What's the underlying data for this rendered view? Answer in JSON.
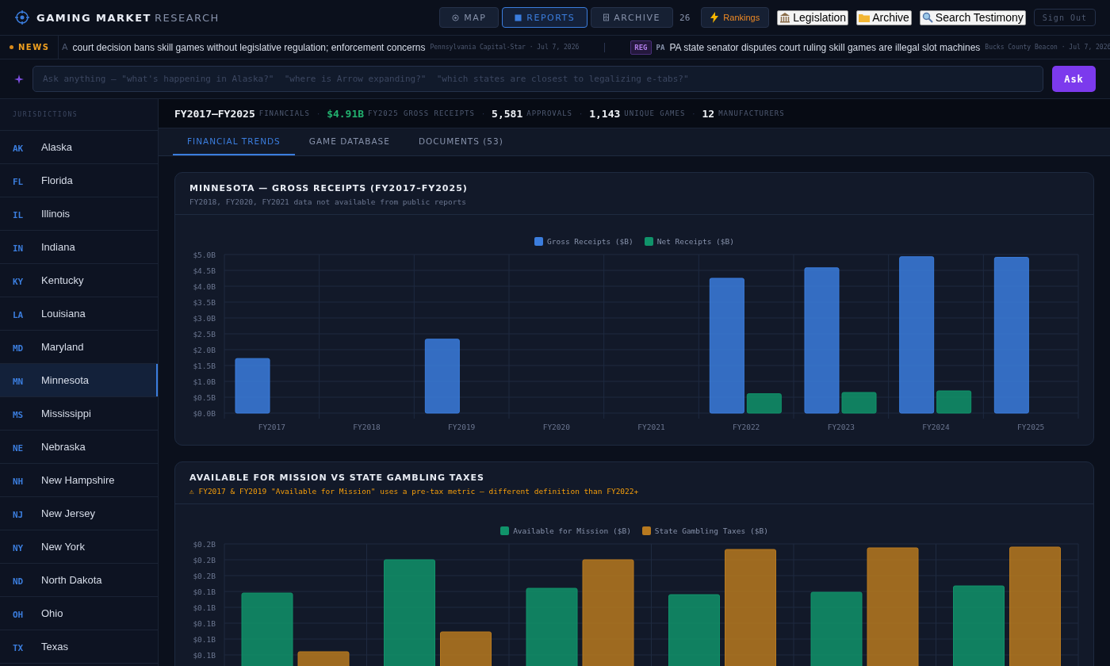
{
  "brand": {
    "name": "GAMING MARKET",
    "suffix": "RESEARCH"
  },
  "nav": [
    {
      "label": "MAP",
      "selected": false
    },
    {
      "label": "REPORTS",
      "selected": true
    },
    {
      "label": "ARCHIVE",
      "selected": false
    }
  ],
  "nav_count": "26",
  "rankings": "Rankings",
  "links": [
    {
      "label": "Legislation"
    },
    {
      "label": "Archive"
    },
    {
      "label": "Search Testimony"
    }
  ],
  "sign_out": "Sign Out",
  "news": {
    "label": "NEWS",
    "items": [
      {
        "state": "A",
        "headline": "court decision bans skill games without legislative regulation; enforcement concerns",
        "source": "Pennsylvania Capital-Star · Jul 7, 2026"
      },
      {
        "tag": "REG",
        "state": "PA",
        "headline": "PA state senator disputes court ruling skill games are illegal slot machines",
        "source": "Bucks County Beacon · Jul 7, 2026"
      }
    ]
  },
  "ask": {
    "placeholder": "Ask anything — \"what's happening in Alaska?\"  \"where is Arrow expanding?\"  \"which states are closest to legalizing e-tabs?\"",
    "button": "Ask"
  },
  "sidebar": {
    "title": "JURISDICTIONS",
    "items": [
      {
        "code": "AK",
        "name": "Alaska",
        "selected": false
      },
      {
        "code": "FL",
        "name": "Florida",
        "selected": false
      },
      {
        "code": "IL",
        "name": "Illinois",
        "selected": false
      },
      {
        "code": "IN",
        "name": "Indiana",
        "selected": false
      },
      {
        "code": "KY",
        "name": "Kentucky",
        "selected": false
      },
      {
        "code": "LA",
        "name": "Louisiana",
        "selected": false
      },
      {
        "code": "MD",
        "name": "Maryland",
        "selected": false
      },
      {
        "code": "MN",
        "name": "Minnesota",
        "selected": true
      },
      {
        "code": "MS",
        "name": "Mississippi",
        "selected": false
      },
      {
        "code": "NE",
        "name": "Nebraska",
        "selected": false
      },
      {
        "code": "NH",
        "name": "New Hampshire",
        "selected": false
      },
      {
        "code": "NJ",
        "name": "New Jersey",
        "selected": false
      },
      {
        "code": "NY",
        "name": "New York",
        "selected": false
      },
      {
        "code": "ND",
        "name": "North Dakota",
        "selected": false
      },
      {
        "code": "OH",
        "name": "Ohio",
        "selected": false
      },
      {
        "code": "TX",
        "name": "Texas",
        "selected": false
      }
    ]
  },
  "stat_separator": "·",
  "stats": [
    {
      "value": "FY2017–FY2025",
      "label": "FINANCIALS",
      "highlight": false
    },
    {
      "value": "$4.91B",
      "label": "FY2025 GROSS RECEIPTS",
      "highlight": true
    },
    {
      "value": "5,581",
      "label": "APPROVALS",
      "highlight": false
    },
    {
      "value": "1,143",
      "label": "UNIQUE GAMES",
      "highlight": false
    },
    {
      "value": "12",
      "label": "MANUFACTURERS",
      "highlight": false
    }
  ],
  "tabs": [
    {
      "label": "FINANCIAL TRENDS",
      "selected": true
    },
    {
      "label": "GAME DATABASE",
      "selected": false
    },
    {
      "label": "DOCUMENTS (53)",
      "selected": false
    }
  ],
  "cards": [
    {
      "title": "MINNESOTA — GROSS RECEIPTS (FY2017–FY2025)",
      "note": "FY2018, FY2020, FY2021 data not available from public reports",
      "warning": false,
      "chart_data": {
        "type": "bar",
        "grid": true,
        "legend": true,
        "categories": [
          "FY2017",
          "FY2018",
          "FY2019",
          "FY2020",
          "FY2021",
          "FY2022",
          "FY2023",
          "FY2024",
          "FY2025"
        ],
        "series": [
          {
            "name": "Gross Receipts ($B)",
            "color": "#3b7ddd",
            "values": [
              1.72,
              null,
              2.33,
              null,
              null,
              4.25,
              4.58,
              4.93,
              4.91
            ]
          },
          {
            "name": "Net Receipts ($B)",
            "color": "#10936a",
            "values": [
              null,
              null,
              null,
              null,
              null,
              0.61,
              0.65,
              0.7,
              null
            ]
          }
        ],
        "ylim": [
          0,
          5
        ],
        "yticks": [
          {
            "value": 0,
            "label": "$0.0B"
          },
          {
            "value": 0.5,
            "label": "$0.5B"
          },
          {
            "value": 1,
            "label": "$1.0B"
          },
          {
            "value": 1.5,
            "label": "$1.5B"
          },
          {
            "value": 2,
            "label": "$2.0B"
          },
          {
            "value": 2.5,
            "label": "$2.5B"
          },
          {
            "value": 3,
            "label": "$3.0B"
          },
          {
            "value": 3.5,
            "label": "$3.5B"
          },
          {
            "value": 4,
            "label": "$4.0B"
          },
          {
            "value": 4.5,
            "label": "$4.5B"
          },
          {
            "value": 5,
            "label": "$5.0B"
          }
        ]
      }
    },
    {
      "title": "AVAILABLE FOR MISSION VS STATE GAMBLING TAXES",
      "note": "⚠ FY2017 & FY2019 \"Available for Mission\" uses a pre-tax metric — different definition than FY2022+",
      "warning": true,
      "chart_data": {
        "type": "bar",
        "grid": true,
        "legend": true,
        "series": [
          {
            "name": "Available for Mission ($B)",
            "color": "#10936a",
            "values": [
              0.138,
              0.18,
              0.144,
              0.136,
              0.139,
              0.147
            ]
          },
          {
            "name": "State Gambling Taxes ($B)",
            "color": "#b7791f",
            "values": [
              0.064,
              0.089,
              0.18,
              0.193,
              0.195,
              0.196
            ]
          }
        ],
        "ylim": [
          0,
          0.2
        ],
        "yticks": [
          {
            "value": 0.06,
            "label": "$0.1B"
          },
          {
            "value": 0.08,
            "label": "$0.1B"
          },
          {
            "value": 0.1,
            "label": "$0.1B"
          },
          {
            "value": 0.12,
            "label": "$0.1B"
          },
          {
            "value": 0.14,
            "label": "$0.1B"
          },
          {
            "value": 0.16,
            "label": "$0.2B"
          },
          {
            "value": 0.18,
            "label": "$0.2B"
          },
          {
            "value": 0.2,
            "label": "$0.2B"
          }
        ]
      }
    }
  ]
}
